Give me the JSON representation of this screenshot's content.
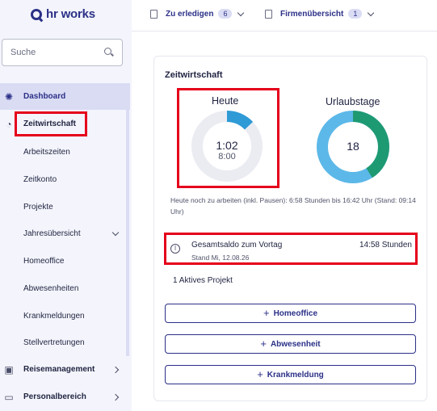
{
  "app": {
    "logo_text": "hr works"
  },
  "search": {
    "placeholder": "Suche"
  },
  "sidebar": {
    "dashboard": "Dashboard",
    "zeitwirtschaft": "Zeitwirtschaft",
    "sub_items": [
      "Arbeitszeiten",
      "Zeitkonto",
      "Projekte",
      "Jahresübersicht",
      "Homeoffice",
      "Abwesenheiten",
      "Krankmeldungen",
      "Stellvertretungen"
    ],
    "reisemanagement": "Reisemanagement",
    "personalbereich": "Personalbereich"
  },
  "topbar": {
    "todo_label": "Zu erledigen",
    "todo_count": "6",
    "company_label": "Firmenübersicht",
    "company_count": "1"
  },
  "card": {
    "title": "Zeitwirtschaft",
    "today_title": "Heute",
    "today_worked": "1:02",
    "today_target": "8:00",
    "today_fraction": 0.13,
    "vacation_title": "Urlaubstage",
    "vacation_value": "18",
    "note": "Heute noch zu arbeiten (inkl. Pausen): 6:58 Stunden bis 16:42 Uhr (Stand: 09:14 Uhr)",
    "saldo_title": "Gesamtsaldo zum Vortag",
    "saldo_sub": "Stand Mi, 12.08.26",
    "saldo_value": "14:58 Stunden",
    "projects": "1 Aktives Projekt",
    "buttons": [
      "Homeoffice",
      "Abwesenheit",
      "Krankmeldung"
    ]
  },
  "colors": {
    "accent": "#2b3087",
    "highlight": "#e5001b",
    "donut_progress": "#2e9ad6",
    "donut_track": "#ebecf2",
    "vacation_green": "#1e9a73",
    "vacation_blue": "#5cb8e8"
  }
}
